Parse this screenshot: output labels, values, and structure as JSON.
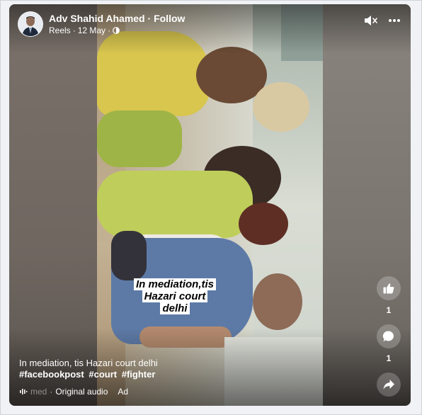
{
  "post": {
    "author": "Adv Shahid Ahamed",
    "follow_label": "Follow",
    "separator": "·",
    "source": "Reels",
    "date": "12 May",
    "meta_sep": "·"
  },
  "video_overlay": {
    "caption_line1": "In mediation,tis",
    "caption_line2": "Hazari court",
    "caption_line3": "delhi"
  },
  "actions": {
    "like_count": "1",
    "comment_count": "1",
    "share_count": ""
  },
  "description": {
    "text": "In mediation, tis Hazari court delhi",
    "hashtags": [
      "#facebookpost",
      "#court",
      "#fighter"
    ]
  },
  "audio": {
    "faded_text": "med",
    "sep": "·",
    "label": "Original audio",
    "extra": "Ad"
  },
  "icons": {
    "mute": "speaker-muted-icon",
    "more": "more-dots-icon",
    "privacy": "globe-icon",
    "like": "thumbs-up-icon",
    "comment": "comment-bubble-icon",
    "share": "share-arrow-icon",
    "audio": "audio-wave-icon"
  },
  "colors": {
    "page_bg": "#f0f2f5",
    "overlay_text": "#ffffff"
  }
}
